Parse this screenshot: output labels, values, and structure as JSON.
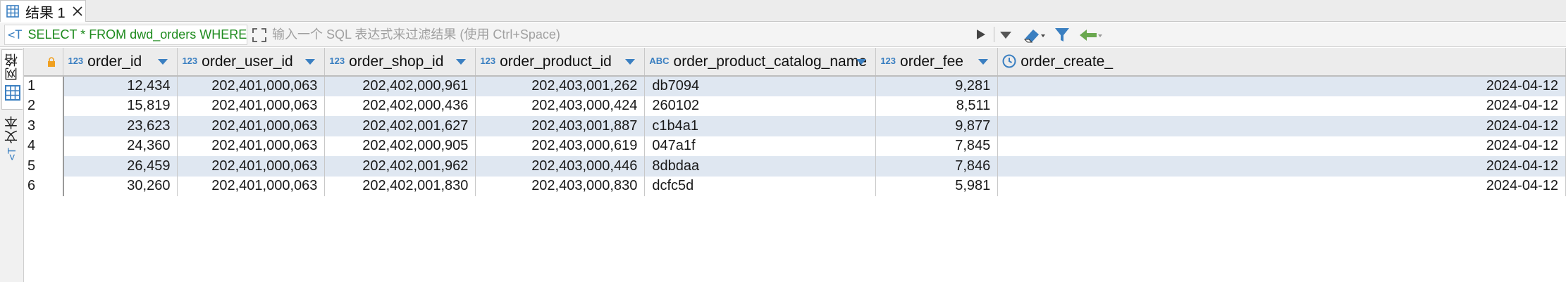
{
  "tab": {
    "label": "结果 1"
  },
  "filter": {
    "sql": "SELECT * FROM dwd_orders WHERE",
    "placeholder": "输入一个 SQL 表达式来过滤结果 (使用 Ctrl+Space)"
  },
  "side_tabs": [
    {
      "label": "网格"
    },
    {
      "label": "文本"
    }
  ],
  "table": {
    "columns": [
      {
        "type": "123",
        "name": "order_id"
      },
      {
        "type": "123",
        "name": "order_user_id"
      },
      {
        "type": "123",
        "name": "order_shop_id"
      },
      {
        "type": "123",
        "name": "order_product_id"
      },
      {
        "type": "ABC",
        "name": "order_product_catalog_name"
      },
      {
        "type": "123",
        "name": "order_fee"
      },
      {
        "type": "clock",
        "name": "order_create_"
      }
    ],
    "rows": [
      {
        "n": "1",
        "cells": [
          "12,434",
          "202,401,000,063",
          "202,402,000,961",
          "202,403,001,262",
          "db7094",
          "9,281",
          "2024-04-12"
        ]
      },
      {
        "n": "2",
        "cells": [
          "15,819",
          "202,401,000,063",
          "202,402,000,436",
          "202,403,000,424",
          "260102",
          "8,511",
          "2024-04-12"
        ]
      },
      {
        "n": "3",
        "cells": [
          "23,623",
          "202,401,000,063",
          "202,402,001,627",
          "202,403,001,887",
          "c1b4a1",
          "9,877",
          "2024-04-12"
        ]
      },
      {
        "n": "4",
        "cells": [
          "24,360",
          "202,401,000,063",
          "202,402,000,905",
          "202,403,000,619",
          "047a1f",
          "7,845",
          "2024-04-12"
        ]
      },
      {
        "n": "5",
        "cells": [
          "26,459",
          "202,401,000,063",
          "202,402,001,962",
          "202,403,000,446",
          "8dbdaa",
          "7,846",
          "2024-04-12"
        ]
      },
      {
        "n": "6",
        "cells": [
          "30,260",
          "202,401,000,063",
          "202,402,001,830",
          "202,403,000,830",
          "dcfc5d",
          "5,981",
          "2024-04-12"
        ]
      }
    ]
  },
  "colors": {
    "accent": "#3a7fc1",
    "sql_text": "#1c8a1c",
    "row_stripe": "#dfe7f1",
    "lock": "#f0a020"
  }
}
